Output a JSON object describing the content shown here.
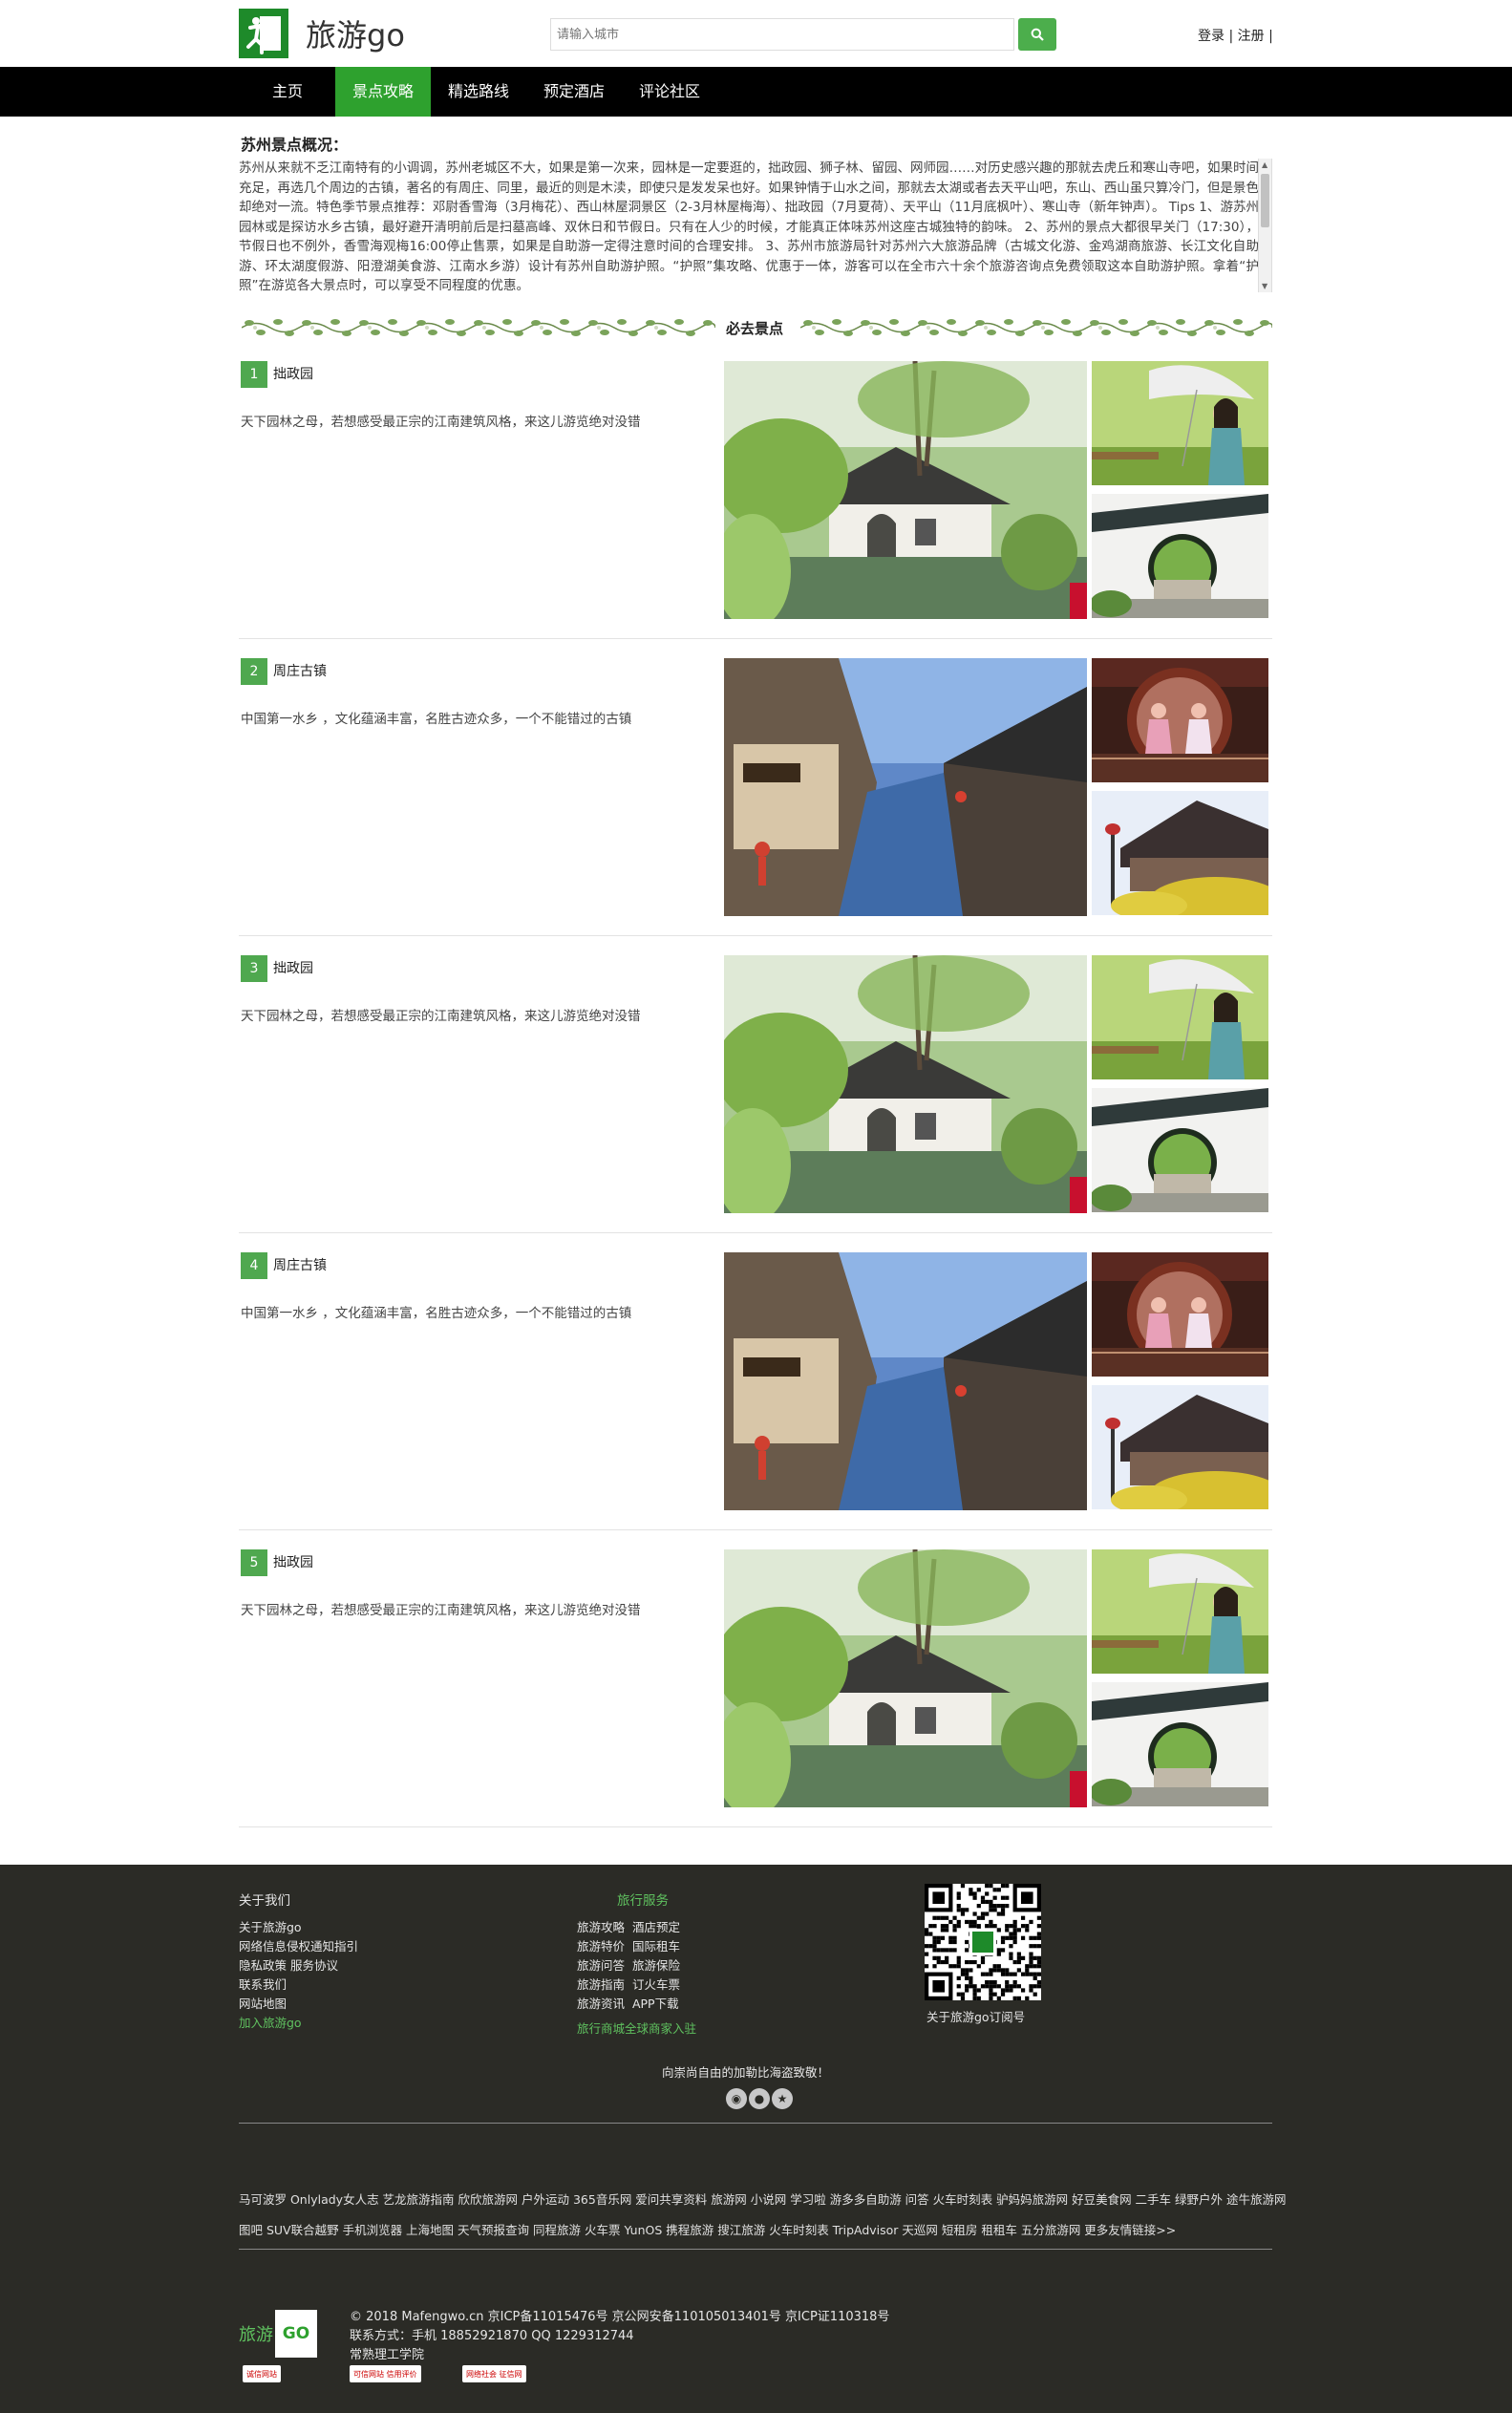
{
  "header": {
    "logo_text": "旅游go",
    "search_placeholder": "请输入城市",
    "login": "登录",
    "register": "注册"
  },
  "nav": [
    {
      "label": "主页",
      "active": false
    },
    {
      "label": "景点攻略",
      "active": true
    },
    {
      "label": "精选路线",
      "active": false
    },
    {
      "label": "预定酒店",
      "active": false
    },
    {
      "label": "评论社区",
      "active": false
    }
  ],
  "overview": {
    "title": "苏州景点概况：",
    "text": "苏州从来就不乏江南特有的小调调，苏州老城区不大，如果是第一次来，园林是一定要逛的，拙政园、狮子林、留园、网师园……对历史感兴趣的那就去虎丘和寒山寺吧，如果时间充足，再选几个周边的古镇，著名的有周庄、同里，最近的则是木渎，即使只是发发呆也好。如果钟情于山水之间，那就去太湖或者去天平山吧，东山、西山虽只算冷门，但是景色却绝对一流。特色季节景点推荐：邓尉香雪海（3月梅花）、西山林屋洞景区（2-3月林屋梅海）、拙政园（7月夏荷）、天平山（11月底枫叶）、寒山寺（新年钟声）。 Tips 1、游苏州园林或是探访水乡古镇，最好避开清明前后是扫墓高峰、双休日和节假日。只有在人少的时候，才能真正体味苏州这座古城独特的韵味。 2、苏州的景点大都很早关门（17:30），节假日也不例外，香雪海观梅16:00停止售票，如果是自助游一定得注意时间的合理安排。 3、苏州市旅游局针对苏州六大旅游品牌（古城文化游、金鸡湖商旅游、长江文化自助游、环太湖度假游、阳澄湖美食游、江南水乡游）设计有苏州自助游护照。“护照”集攻略、优惠于一体，游客可以在全市六十余个旅游咨询点免费领取这本自助游护照。拿着“护照”在游览各大景点时，可以享受不同程度的优惠。"
  },
  "must_title": "必去景点",
  "spots": [
    {
      "num": "1",
      "name": "拙政园",
      "desc": "天下园林之母，若想感受最正宗的江南建筑风格，来这儿游览绝对没错",
      "type": "garden"
    },
    {
      "num": "2",
      "name": "周庄古镇",
      "desc": "中国第一水乡 ，文化蕴涵丰富，名胜古迹众多，一个不能错过的古镇",
      "type": "town"
    },
    {
      "num": "3",
      "name": "拙政园",
      "desc": "天下园林之母，若想感受最正宗的江南建筑风格，来这儿游览绝对没错",
      "type": "garden"
    },
    {
      "num": "4",
      "name": "周庄古镇",
      "desc": "中国第一水乡 ，文化蕴涵丰富，名胜古迹众多，一个不能错过的古镇",
      "type": "town"
    },
    {
      "num": "5",
      "name": "拙政园",
      "desc": "天下园林之母，若想感受最正宗的江南建筑风格，来这儿游览绝对没错",
      "type": "garden"
    }
  ],
  "footer": {
    "about_title": "关于我们",
    "about_links": [
      "关于旅游go",
      "网络信息侵权通知指引",
      "隐私政策  服务协议",
      "联系我们",
      "网站地图",
      "加入旅游go"
    ],
    "service_title": "旅行服务",
    "service_links": [
      [
        "旅游攻略",
        "酒店预定"
      ],
      [
        "旅游特价",
        "国际租车"
      ],
      [
        "旅游问答",
        "旅游保险"
      ],
      [
        "旅游指南",
        "订火车票"
      ],
      [
        "旅游资讯",
        "APP下载"
      ]
    ],
    "service_bottom": "旅行商城全球商家入驻",
    "qr_caption": "关于旅游go订阅号",
    "slogan": "向崇尚自由的加勒比海盗致敬！",
    "links_line1": "马可波罗 Onlylady女人志 艺龙旅游指南 欣欣旅游网 户外运动 365音乐网 爱问共享资料 旅游网 小说网 学习啦 游多多自助游 问答 火车时刻表 驴妈妈旅游网 好豆美食网 二手车 绿野户外 途牛旅游网",
    "links_line2": "图吧 SUV联合越野 手机浏览器 上海地图 天气预报查询 同程旅游 火车票 YunOS 携程旅游 搜江旅游 火车时刻表 TripAdvisor 天巡网 短租房 租租车 五分旅游网 更多友情链接>>",
    "logo_cn": "旅游",
    "logo_go": "GO",
    "copyright": "© 2018 Mafengwo.cn 京ICP备11015476号 京公网安备110105013401号 京ICP证110318号",
    "contact": "联系方式：手机 18852921870 QQ 1229312744",
    "school": "常熟理工学院",
    "badges": [
      "诚信网站",
      "可信网站 信用评价",
      "网络社会 征信网"
    ]
  },
  "colors": {
    "accent": "#2ea12e",
    "footer_bg": "#2b2b26",
    "nav_bg": "#000000"
  }
}
